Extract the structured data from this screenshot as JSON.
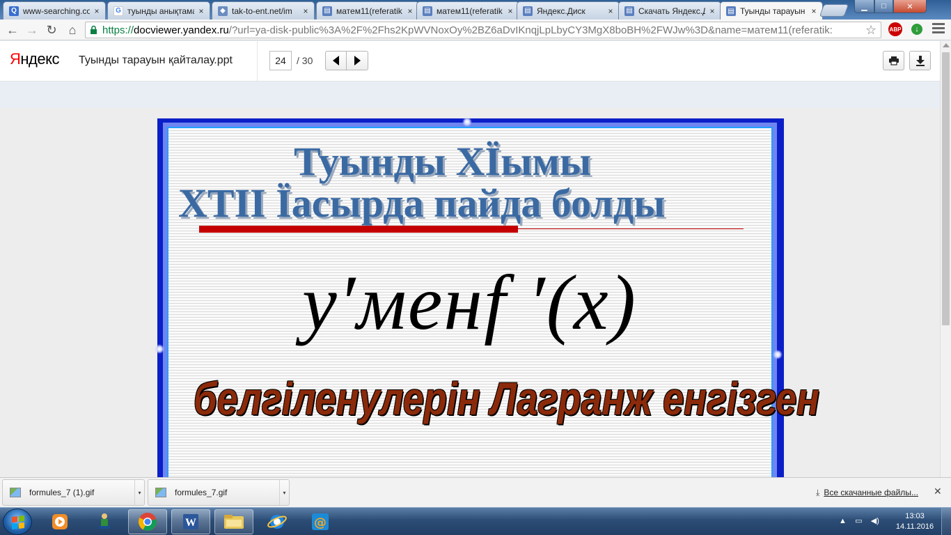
{
  "tabs": [
    {
      "title": "www-searching.co",
      "close": "×",
      "favicon_color": "#3a6fd0"
    },
    {
      "title": "туынды анықтамас",
      "close": "×",
      "favicon_color": "#4285f4"
    },
    {
      "title": "tak-to-ent.net/im",
      "close": "×",
      "favicon_color": "#3a6fd0"
    },
    {
      "title": "матем11(referatik",
      "close": "×",
      "favicon_color": "#3a6fd0"
    },
    {
      "title": "матем11(referatik",
      "close": "×",
      "favicon_color": "#3a6fd0"
    },
    {
      "title": "Яндекс.Диск",
      "close": "×",
      "favicon_color": "#3a6fd0"
    },
    {
      "title": "Скачать Яндекс.Д",
      "close": "×",
      "favicon_color": "#3a6fd0"
    },
    {
      "title": "Туынды тарауын",
      "close": "×",
      "favicon_color": "#3a6fd0"
    }
  ],
  "window_controls": {
    "minimize": "▁",
    "maximize": "□",
    "close": "✕"
  },
  "address_bar": {
    "scheme": "https://",
    "host": "docviewer.yandex.ru",
    "rest": "/?url=ya-disk-public%3A%2F%2Fhs2KpWVNoxOy%2BZ6aDvIKnqjLpLbyCY3MgX8boBH%2FWJw%3D&name=матем11(referatik:"
  },
  "extensions": {
    "adblock_label": "ABP"
  },
  "viewer": {
    "logo_part1": "Я",
    "logo_part2": "ндекс",
    "document_title": "Туынды тарауын қайталау.ppt",
    "current_page": "24",
    "total_pages": "/ 30"
  },
  "slide": {
    "heading_line1": "Туынды ХЇымы",
    "heading_line2": "ХТІІ Їасырда пайда болды",
    "formula": "y′менf ′(x)",
    "caption": "белгіленулерін Лагранж енгізген"
  },
  "downloads": {
    "items": [
      {
        "filename": "formules_7 (1).gif"
      },
      {
        "filename": "formules_7.gif"
      }
    ],
    "all_downloads_label": "Все скачанные файлы..."
  },
  "taskbar": {
    "clock_time": "13:03",
    "clock_date": "14.11.2016"
  }
}
